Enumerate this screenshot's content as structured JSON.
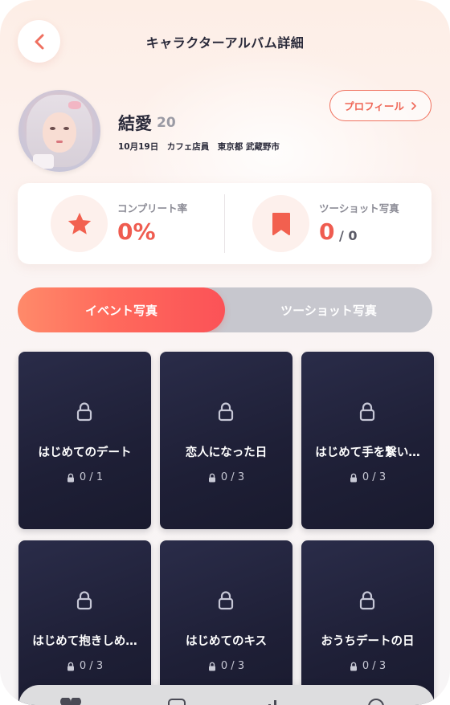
{
  "header": {
    "title": "キャラクターアルバム詳細"
  },
  "character": {
    "name": "結愛",
    "age": "20",
    "meta": "10月19日　カフェ店員　東京都 武蔵野市"
  },
  "profile_button": {
    "label": "プロフィール"
  },
  "stats": {
    "completion": {
      "label": "コンプリート率",
      "value": "0%"
    },
    "two_shot": {
      "label": "ツーショット写真",
      "value": "0",
      "total": "/ 0"
    }
  },
  "tabs": [
    {
      "label": "イベント写真",
      "active": true
    },
    {
      "label": "ツーショット写真",
      "active": false
    }
  ],
  "albums": [
    {
      "title": "はじめてのデート",
      "count": "0 / 1"
    },
    {
      "title": "恋人になった日",
      "count": "0 / 3"
    },
    {
      "title": "はじめて手を繋い…",
      "count": "0 / 3"
    },
    {
      "title": "はじめて抱きしめ…",
      "count": "0 / 3"
    },
    {
      "title": "はじめてのキス",
      "count": "0 / 3"
    },
    {
      "title": "おうちデートの日",
      "count": "0 / 3"
    }
  ],
  "colors": {
    "accent": "#ef5c50",
    "accent_gradient_start": "#ff8a6a",
    "card_dark": "#1e1f36",
    "tab_inactive": "#c7c7ce"
  },
  "icons": {
    "back": "chevron-left-icon",
    "completion": "star-icon",
    "two_shot": "bookmark-icon",
    "album_locked": "lock-icon"
  }
}
